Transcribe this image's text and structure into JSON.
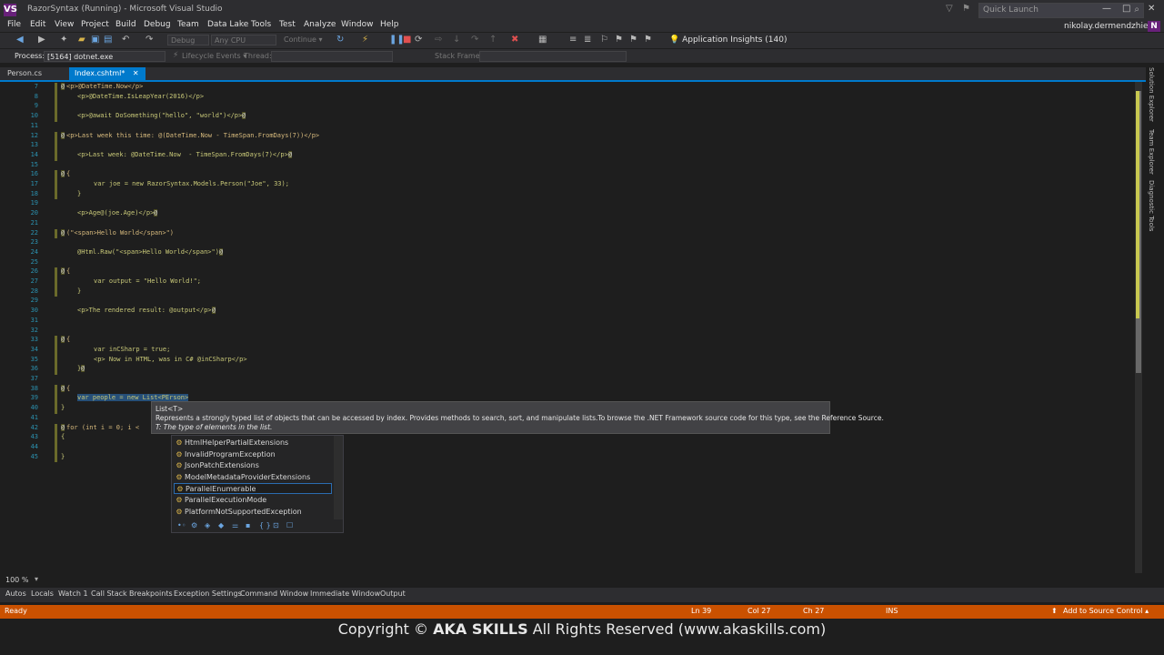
{
  "window": {
    "title": "RazorSyntax (Running) - Microsoft Visual Studio",
    "logo": "VS",
    "quick_launch_placeholder": "Quick Launch",
    "controls": [
      "—",
      "□",
      "✕"
    ]
  },
  "menu": {
    "items": [
      "File",
      "Edit",
      "View",
      "Project",
      "Build",
      "Debug",
      "Team",
      "Data Lake",
      "Tools",
      "Test",
      "Analyze",
      "Window",
      "Help"
    ],
    "user": "nikolay.dermendzhiev",
    "avatar": "N"
  },
  "toolbar": {
    "config": "Debug",
    "platform": "Any CPU",
    "continue": "Continue ▾",
    "app_insights": "Application Insights (140)"
  },
  "process_bar": {
    "process_label": "Process:",
    "process_value": "[5164] dotnet.exe",
    "lifecycle_label": "Lifecycle Events ▾",
    "thread_label": "Thread:",
    "stack_label": "Stack Frame:"
  },
  "tabs": [
    {
      "label": "Person.cs",
      "active": false
    },
    {
      "label": "Index.cshtml*",
      "active": true,
      "close": "✕"
    }
  ],
  "editor": {
    "lines": [
      {
        "n": "7",
        "code": "<p>@DateTime.Now</p>",
        "indent": 0,
        "at": true
      },
      {
        "n": "8",
        "code": "<p>@DateTime.IsLeapYear(2016)</p>",
        "indent": 1
      },
      {
        "n": "9",
        "code": ""
      },
      {
        "n": "10",
        "code": "<p>@await DoSomething(\"hello\", \"world\")</p>",
        "indent": 1,
        "tail": true
      },
      {
        "n": "11",
        "code": ""
      },
      {
        "n": "12",
        "code": "<p>Last week this time: @(DateTime.Now - TimeSpan.FromDays(7))</p>",
        "indent": 0,
        "at": true
      },
      {
        "n": "13",
        "code": ""
      },
      {
        "n": "14",
        "code": "<p>Last week: @DateTime.Now  - TimeSpan.FromDays(7)</p>",
        "indent": 1,
        "tail": true
      },
      {
        "n": "15",
        "code": ""
      },
      {
        "n": "16",
        "code": "{",
        "indent": 0,
        "at": true
      },
      {
        "n": "17",
        "code": "var joe = new RazorSyntax.Models.Person(\"Joe\", 33);",
        "indent": 2
      },
      {
        "n": "18",
        "code": "}",
        "indent": 1
      },
      {
        "n": "19",
        "code": ""
      },
      {
        "n": "20",
        "code": "<p>Age@(joe.Age)</p>",
        "indent": 1,
        "tail": true
      },
      {
        "n": "21",
        "code": ""
      },
      {
        "n": "22",
        "code": "(\"<span>Hello World</span>\")",
        "indent": 0,
        "at": true
      },
      {
        "n": "23",
        "code": ""
      },
      {
        "n": "24",
        "code": "@Html.Raw(\"<span>Hello World</span>\")",
        "indent": 1,
        "tail": true
      },
      {
        "n": "25",
        "code": ""
      },
      {
        "n": "26",
        "code": "{",
        "indent": 0,
        "at": true
      },
      {
        "n": "27",
        "code": "var output = \"Hello World!\";",
        "indent": 2
      },
      {
        "n": "28",
        "code": "}",
        "indent": 1
      },
      {
        "n": "29",
        "code": ""
      },
      {
        "n": "30",
        "code": "<p>The rendered result: @output</p>",
        "indent": 1,
        "tail": true
      },
      {
        "n": "31",
        "code": ""
      },
      {
        "n": "32",
        "code": ""
      },
      {
        "n": "33",
        "code": "{",
        "indent": 0,
        "at": true
      },
      {
        "n": "34",
        "code": "var inCSharp = true;",
        "indent": 2
      },
      {
        "n": "35",
        "code": "<p> Now in HTML, was in C# @inCSharp</p>",
        "indent": 2
      },
      {
        "n": "36",
        "code": "}",
        "indent": 1,
        "tail": true
      },
      {
        "n": "37",
        "code": ""
      },
      {
        "n": "38",
        "code": "{",
        "indent": 0,
        "at": true
      },
      {
        "n": "39",
        "code": "var people = new List<PErson>",
        "indent": 1
      },
      {
        "n": "40",
        "code": "}",
        "indent": 0
      },
      {
        "n": "41",
        "code": ""
      },
      {
        "n": "42",
        "code": "for (int i = 0; i <",
        "indent": 0,
        "at": true
      },
      {
        "n": "43",
        "code": "{",
        "indent": 0
      },
      {
        "n": "44",
        "code": ""
      },
      {
        "n": "45",
        "code": "}",
        "indent": 0
      }
    ]
  },
  "tooltip": {
    "signature": "List<T>",
    "description": "Represents a strongly typed list of objects that can be accessed by index. Provides methods to search, sort, and manipulate lists.To browse the .NET Framework source code for this type, see the Reference Source.",
    "param": "T: The type of elements in the list."
  },
  "intellisense": {
    "items": [
      "HtmlHelperPartialExtensions",
      "InvalidProgramException",
      "JsonPatchExtensions",
      "ModelMetadataProviderExtensions",
      "ParallelEnumerable",
      "ParallelExecutionMode",
      "PlatformNotSupportedException"
    ],
    "selected_index": 4,
    "filters": [
      "•◦",
      "⚙",
      "◈",
      "◆",
      "⚌",
      "▪",
      "{ }",
      "⊡",
      "☐"
    ]
  },
  "zoom": "100 %",
  "bottom_tabs": [
    "Autos",
    "Locals",
    "Watch 1",
    "Call Stack",
    "Breakpoints",
    "Exception Settings",
    "Command Window",
    "Immediate Window",
    "Output"
  ],
  "status": {
    "ready": "Ready",
    "ln": "Ln 39",
    "col": "Col 27",
    "ch": "Ch 27",
    "ins": "INS",
    "source_control": "Add to Source Control ▴"
  },
  "side_tabs": [
    "Solution Explorer",
    "Team Explorer",
    "Diagnostic Tools"
  ],
  "copyright": {
    "prefix": "Copyright ©",
    "brand": "AKA SKILLS",
    "suffix": "All Rights Reserved (www.akaskills.com)"
  }
}
